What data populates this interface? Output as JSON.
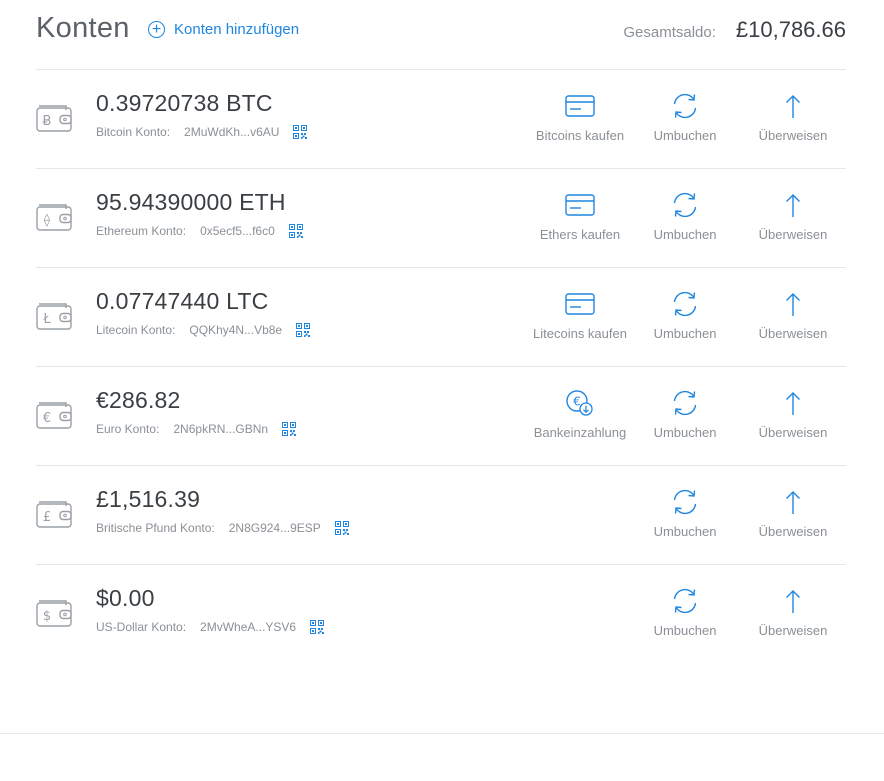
{
  "header": {
    "title": "Konten",
    "add_label": "Konten hinzufügen",
    "total_label": "Gesamtsaldo:",
    "total_value": "£10,786.66"
  },
  "colors": {
    "accent": "#1f86e0",
    "text_muted": "#8a9096",
    "divider": "#e4e6e8"
  },
  "accounts": [
    {
      "symbol": "Ƀ",
      "icon": "wallet-bitcoin-icon",
      "balance": "0.39720738 BTC",
      "label": "Bitcoin Konto:",
      "address": "2MuWdKh...v6AU",
      "buy_label": "Bitcoins kaufen",
      "buy_icon": "card-icon",
      "convert_label": "Umbuchen",
      "send_label": "Überweisen"
    },
    {
      "symbol": "⟠",
      "icon": "wallet-ethereum-icon",
      "balance": "95.94390000 ETH",
      "label": "Ethereum Konto:",
      "address": "0x5ecf5...f6c0",
      "buy_label": "Ethers kaufen",
      "buy_icon": "card-icon",
      "convert_label": "Umbuchen",
      "send_label": "Überweisen"
    },
    {
      "symbol": "Ł",
      "icon": "wallet-litecoin-icon",
      "balance": "0.07747440 LTC",
      "label": "Litecoin Konto:",
      "address": "QQKhy4N...Vb8e",
      "buy_label": "Litecoins kaufen",
      "buy_icon": "card-icon",
      "convert_label": "Umbuchen",
      "send_label": "Überweisen"
    },
    {
      "symbol": "€",
      "icon": "wallet-euro-icon",
      "balance": "€286.82",
      "label": "Euro Konto:",
      "address": "2N6pkRN...GBNn",
      "buy_label": "Bankeinzahlung",
      "buy_icon": "euro-deposit-icon",
      "convert_label": "Umbuchen",
      "send_label": "Überweisen"
    },
    {
      "symbol": "£",
      "icon": "wallet-pound-icon",
      "balance": "£1,516.39",
      "label": "Britische Pfund Konto:",
      "address": "2N8G924...9ESP",
      "buy_label": null,
      "convert_label": "Umbuchen",
      "send_label": "Überweisen"
    },
    {
      "symbol": "$",
      "icon": "wallet-dollar-icon",
      "balance": "$0.00",
      "label": "US-Dollar Konto:",
      "address": "2MvWheA...YSV6",
      "buy_label": null,
      "convert_label": "Umbuchen",
      "send_label": "Überweisen"
    }
  ]
}
